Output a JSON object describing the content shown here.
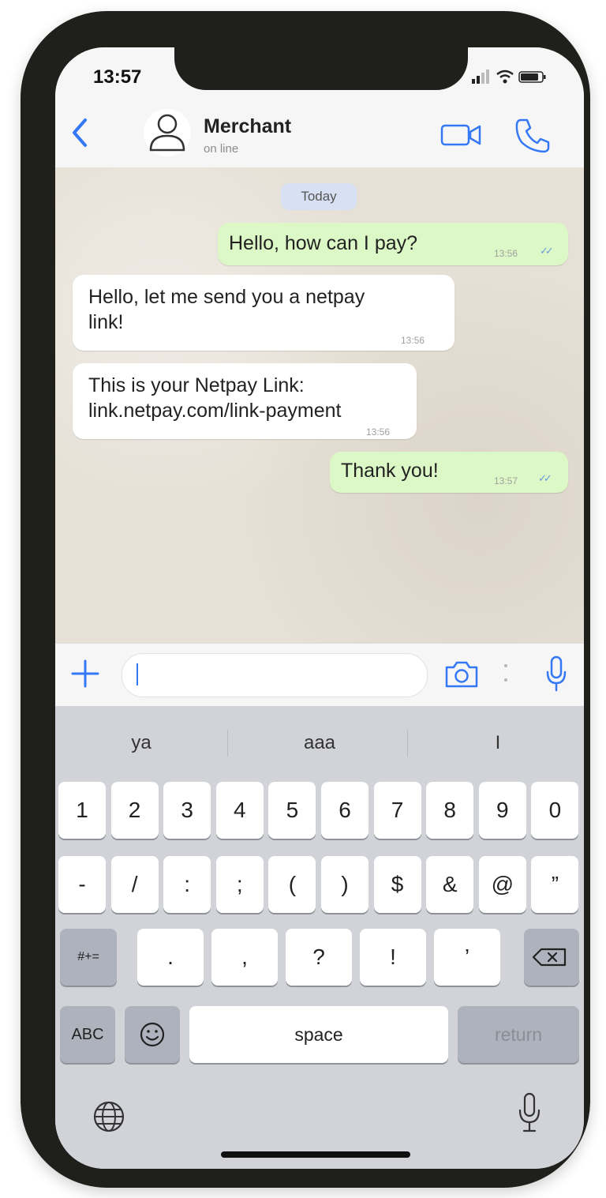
{
  "status_bar": {
    "time": "13:57"
  },
  "header": {
    "contact_name": "Merchant",
    "contact_status": "on line"
  },
  "chat": {
    "date_label": "Today",
    "messages": [
      {
        "direction": "outgoing",
        "text": "Hello, how can I pay?",
        "time": "13:56",
        "read": true
      },
      {
        "direction": "incoming",
        "line1": "Hello, let me send you a netpay",
        "line2": "link!",
        "time": "13:56"
      },
      {
        "direction": "incoming",
        "line1": "This is your Netpay Link:",
        "line2": "link.netpay.com/link-payment",
        "time": "13:56"
      },
      {
        "direction": "outgoing",
        "text": "Thank you!",
        "time": "13:57",
        "read": true
      }
    ]
  },
  "input": {
    "value": ""
  },
  "keyboard": {
    "suggestions": [
      "ya",
      "aaa",
      "I"
    ],
    "row1": [
      "1",
      "2",
      "3",
      "4",
      "5",
      "6",
      "7",
      "8",
      "9",
      "0"
    ],
    "row2": [
      "-",
      "/",
      ":",
      ";",
      "(",
      ")",
      "$",
      "&",
      "@",
      "”"
    ],
    "row3": {
      "shift_label": "#+=",
      "keys": [
        ".",
        ",",
        "?",
        "!",
        "’"
      ]
    },
    "row4": {
      "abc_label": "ABC",
      "space_label": "space",
      "return_label": "return"
    }
  },
  "colors": {
    "accent": "#3478f6",
    "outgoing_bubble": "#dcf8c6",
    "incoming_bubble": "#ffffff",
    "date_pill": "#d8e0f4"
  },
  "icons": {
    "back": "chevron-left-icon",
    "avatar": "person-icon",
    "video": "video-camera-icon",
    "call": "phone-icon",
    "attach": "plus-icon",
    "camera": "camera-icon",
    "mic": "microphone-icon",
    "emoji": "emoji-icon",
    "globe": "globe-icon",
    "dictation": "microphone-icon",
    "delete": "backspace-icon"
  }
}
